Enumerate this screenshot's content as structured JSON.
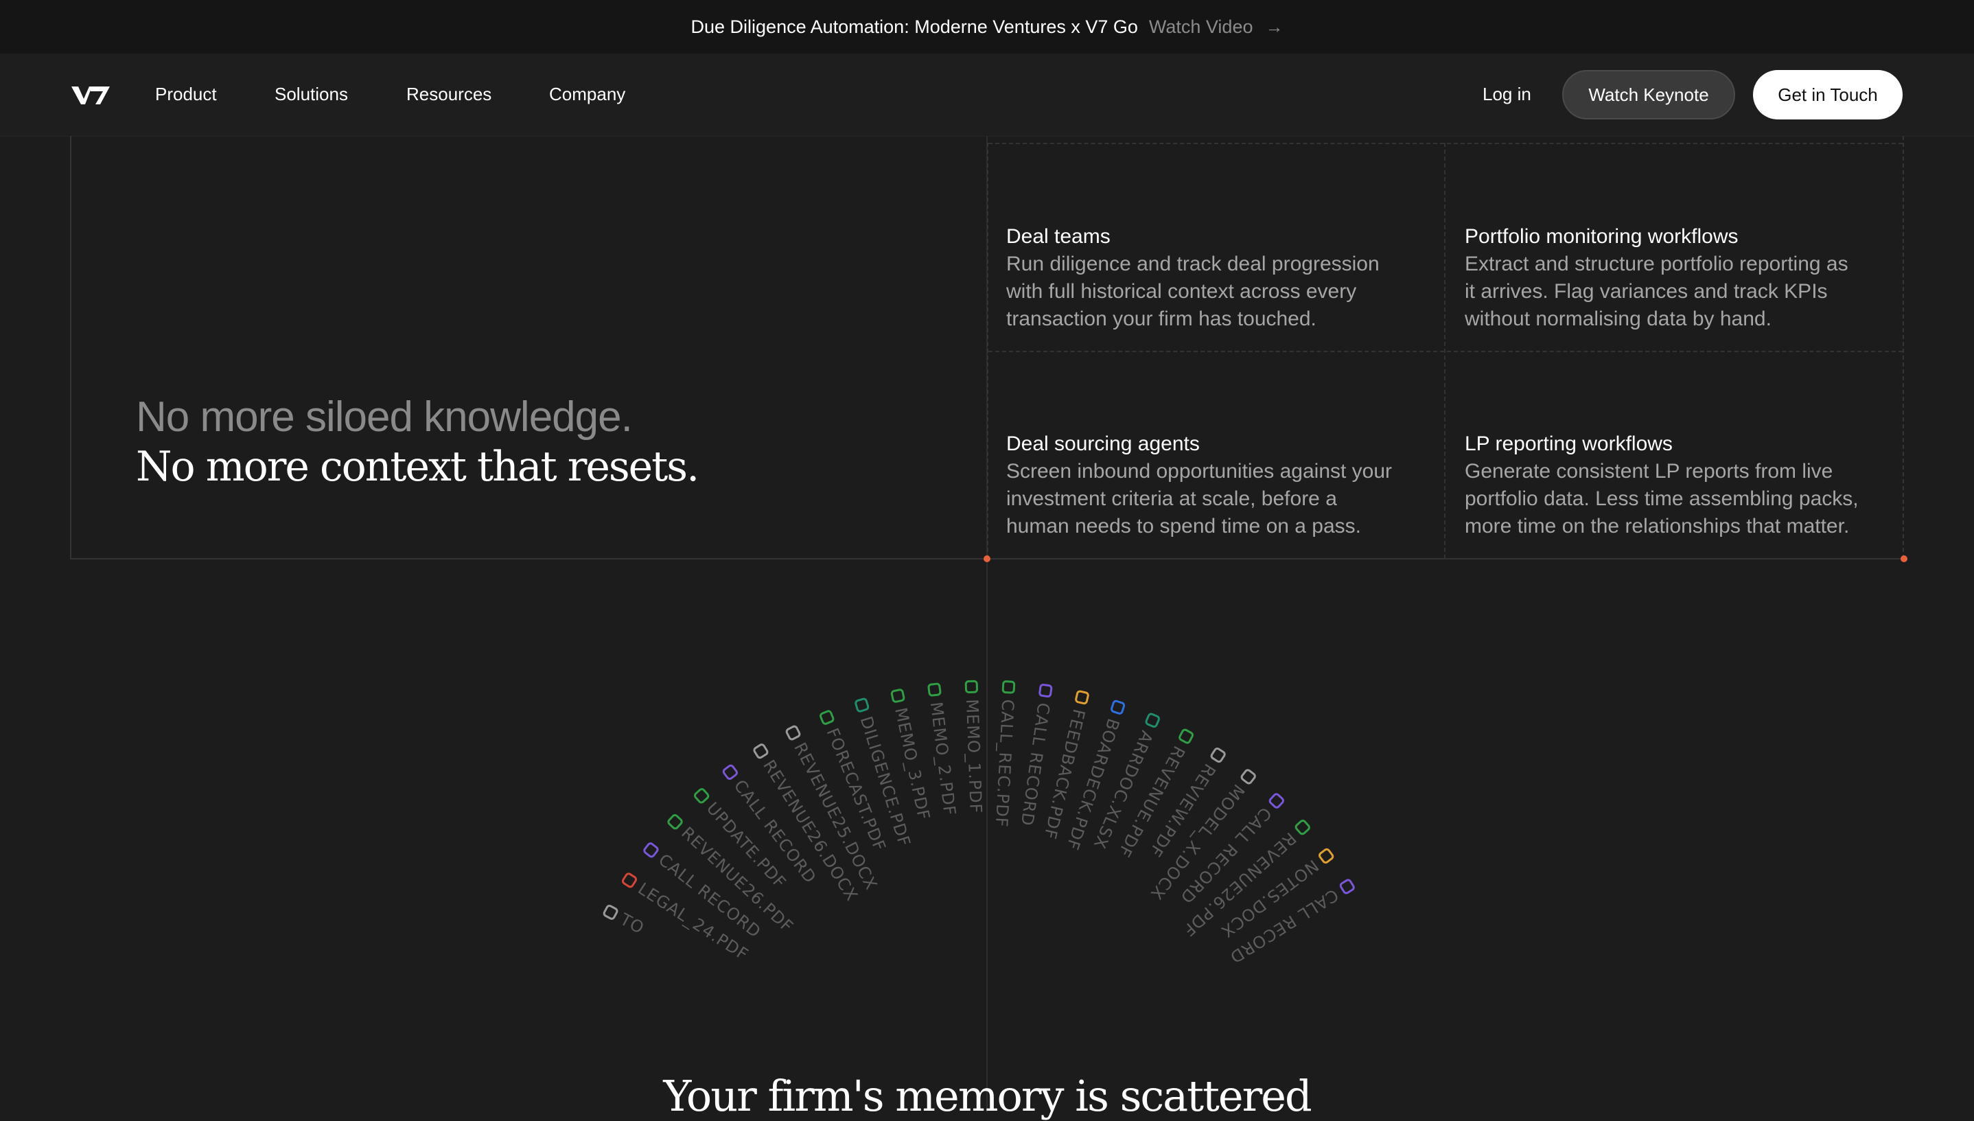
{
  "announcement": {
    "text": "Due Diligence Automation: Moderne Ventures x V7 Go",
    "link": "Watch Video"
  },
  "nav": {
    "logo": "V7",
    "items": [
      "Product",
      "Solutions",
      "Resources",
      "Company"
    ],
    "login": "Log in",
    "keynote": "Watch Keynote",
    "cta": "Get in Touch"
  },
  "hero": {
    "line1": "No more siloed knowledge.",
    "line2": "No more context that resets."
  },
  "cards": [
    {
      "title": "Deal teams",
      "desc": [
        "Run diligence and track deal progression",
        "with full historical context across every",
        "transaction your firm has touched."
      ]
    },
    {
      "title": "Portfolio monitoring workflows",
      "desc": [
        "Extract and structure portfolio reporting as",
        "it arrives. Flag variances and track KPIs",
        "without normalising data by hand."
      ]
    },
    {
      "title": "Deal sourcing agents",
      "desc": [
        "Screen inbound opportunities against your",
        "investment criteria at scale, before a",
        "human needs to spend time on a pass."
      ]
    },
    {
      "title": "LP reporting workflows",
      "desc": [
        "Generate consistent LP reports from live",
        "portfolio data. Less time assembling packs,",
        "more time on the relationships that matter."
      ]
    }
  ],
  "files": [
    {
      "label": "TO",
      "angle": -62,
      "icon": "doc-icon",
      "color": "#9a9a9a"
    },
    {
      "label": "LEGAL_24.PDF",
      "angle": -57,
      "icon": "gmail-icon",
      "color": "#d44638"
    },
    {
      "label": "CALL RECORD",
      "angle": -52,
      "icon": "call-icon",
      "color": "#7a56d8"
    },
    {
      "label": "REVENUE26.PDF",
      "angle": -47,
      "icon": "drive-icon",
      "color": "#2f9e44"
    },
    {
      "label": "UPDATE.PDF",
      "angle": -42,
      "icon": "drive-icon",
      "color": "#2f9e44"
    },
    {
      "label": "CALL RECORD",
      "angle": -37,
      "icon": "call-icon",
      "color": "#7a56d8"
    },
    {
      "label": "REVENUE26.DOCX",
      "angle": -32,
      "icon": "doc-icon",
      "color": "#9a9a9a"
    },
    {
      "label": "REVENUE25.DOCX",
      "angle": -27,
      "icon": "doc-icon",
      "color": "#9a9a9a"
    },
    {
      "label": "FORECAST.PDF",
      "angle": -22,
      "icon": "drive-icon",
      "color": "#2f9e44"
    },
    {
      "label": "DILIGENCE.PDF",
      "angle": -17,
      "icon": "sheets-icon",
      "color": "#1e8e6e"
    },
    {
      "label": "MEMO_3.PDF",
      "angle": -12,
      "icon": "drive-icon",
      "color": "#2f9e44"
    },
    {
      "label": "MEMO_2.PDF",
      "angle": -7,
      "icon": "drive-icon",
      "color": "#2f9e44"
    },
    {
      "label": "MEMO_1.PDF",
      "angle": -2,
      "icon": "drive-icon",
      "color": "#2f9e44"
    },
    {
      "label": "CALL_REC.PDF",
      "angle": 3,
      "icon": "drive-icon",
      "color": "#2f9e44"
    },
    {
      "label": "CALL RECORD",
      "angle": 8,
      "icon": "call-icon",
      "color": "#7a56d8"
    },
    {
      "label": "FEEDBACK.PDF",
      "angle": 13,
      "icon": "slack-icon",
      "color": "#e0a030"
    },
    {
      "label": "BOARDECK.PDF",
      "angle": 18,
      "icon": "dropbox-icon",
      "color": "#2f6fe0"
    },
    {
      "label": "ARRDOC.XLSX",
      "angle": 23,
      "icon": "sheets-icon",
      "color": "#1e8e6e"
    },
    {
      "label": "REVENUE.PDF",
      "angle": 28,
      "icon": "drive-icon",
      "color": "#2f9e44"
    },
    {
      "label": "REVIEW.PDF",
      "angle": 33,
      "icon": "openai-icon",
      "color": "#9a9a9a"
    },
    {
      "label": "MODEL_X.DOCX",
      "angle": 38,
      "icon": "doc-icon",
      "color": "#9a9a9a"
    },
    {
      "label": "CALL RECORD",
      "angle": 43,
      "icon": "call-icon",
      "color": "#7a56d8"
    },
    {
      "label": "REVENUE26.PDF",
      "angle": 48,
      "icon": "drive-icon",
      "color": "#2f9e44"
    },
    {
      "label": "NOTES.DOCX",
      "angle": 53,
      "icon": "slack-icon",
      "color": "#e0a030"
    },
    {
      "label": "CALL RECORD",
      "angle": 58,
      "icon": "call-icon",
      "color": "#7a56d8"
    }
  ],
  "section_title": "Your firm's memory is scattered",
  "colors": {
    "background": "#1c1c1c",
    "accent_dot": "#e8603c",
    "muted": "#8a8a8a"
  }
}
